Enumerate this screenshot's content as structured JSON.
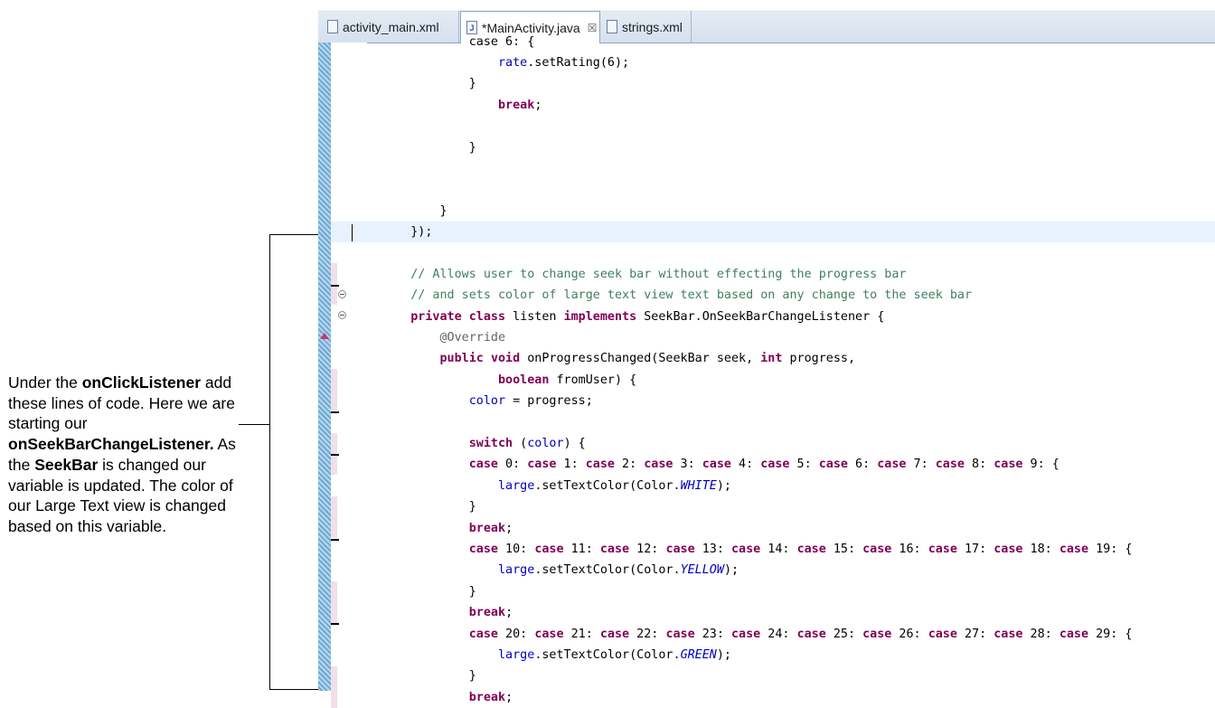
{
  "annotation": {
    "t1": "Under the ",
    "b1": "onClickListener",
    "t2": " add these lines of code. Here we are starting our ",
    "b2": "onSeekBarChangeListener.",
    "t3": " As the ",
    "b3": "SeekBar",
    "t4": " is changed our variable is updated. The color of our Large Text view is changed based on this variable."
  },
  "tabs": [
    {
      "label": "activity_main.xml",
      "icon": "xml-file-icon"
    },
    {
      "label": "*MainActivity.java",
      "icon": "java-file-icon",
      "close": "☒"
    },
    {
      "label": "strings.xml",
      "icon": "xml-file-icon"
    }
  ],
  "code": {
    "l0": [
      {
        "c": "",
        "t": "            case 6: {"
      }
    ],
    "l1": [
      {
        "c": "",
        "t": "                "
      },
      {
        "c": "fld",
        "t": "rate"
      },
      {
        "c": "",
        "t": ".setRating(6);"
      }
    ],
    "l2": [
      {
        "c": "",
        "t": "            }"
      }
    ],
    "l3": [
      {
        "c": "",
        "t": "                "
      },
      {
        "c": "kw",
        "t": "break"
      },
      {
        "c": "",
        "t": ";"
      }
    ],
    "l4": [
      {
        "c": "",
        "t": ""
      }
    ],
    "l5": [
      {
        "c": "",
        "t": "            }"
      }
    ],
    "l6": [
      {
        "c": "",
        "t": ""
      }
    ],
    "l7": [
      {
        "c": "",
        "t": ""
      }
    ],
    "l8": [
      {
        "c": "",
        "t": "        }"
      }
    ],
    "l9": [
      {
        "c": "",
        "t": "    });"
      }
    ],
    "l10": [
      {
        "c": "",
        "t": ""
      }
    ],
    "l11": [
      {
        "c": "",
        "t": "    "
      },
      {
        "c": "cm",
        "t": "// Allows user to change seek bar without effecting the progress bar"
      }
    ],
    "l12": [
      {
        "c": "",
        "t": "    "
      },
      {
        "c": "cm",
        "t": "// and sets color of large text view text based on any change to the seek bar"
      }
    ],
    "l13": [
      {
        "c": "",
        "t": "    "
      },
      {
        "c": "kw",
        "t": "private"
      },
      {
        "c": "",
        "t": " "
      },
      {
        "c": "kw",
        "t": "class"
      },
      {
        "c": "",
        "t": " listen "
      },
      {
        "c": "kw",
        "t": "implements"
      },
      {
        "c": "",
        "t": " SeekBar.OnSeekBarChangeListener {"
      }
    ],
    "l14": [
      {
        "c": "",
        "t": "        "
      },
      {
        "c": "an",
        "t": "@Override"
      }
    ],
    "l15": [
      {
        "c": "",
        "t": "        "
      },
      {
        "c": "kw",
        "t": "public"
      },
      {
        "c": "",
        "t": " "
      },
      {
        "c": "kw",
        "t": "void"
      },
      {
        "c": "",
        "t": " onProgressChanged(SeekBar seek, "
      },
      {
        "c": "kw",
        "t": "int"
      },
      {
        "c": "",
        "t": " progress,"
      }
    ],
    "l16": [
      {
        "c": "",
        "t": "                "
      },
      {
        "c": "kw",
        "t": "boolean"
      },
      {
        "c": "",
        "t": " fromUser) {"
      }
    ],
    "l17": [
      {
        "c": "",
        "t": "            "
      },
      {
        "c": "fld",
        "t": "color"
      },
      {
        "c": "",
        "t": " = progress;"
      }
    ],
    "l18": [
      {
        "c": "",
        "t": ""
      }
    ],
    "l19": [
      {
        "c": "",
        "t": "            "
      },
      {
        "c": "kw",
        "t": "switch"
      },
      {
        "c": "",
        "t": " ("
      },
      {
        "c": "fld",
        "t": "color"
      },
      {
        "c": "",
        "t": ") {"
      }
    ],
    "l20": [
      {
        "c": "",
        "t": "            "
      },
      {
        "c": "kw",
        "t": "case"
      },
      {
        "c": "",
        "t": " 0: "
      },
      {
        "c": "kw",
        "t": "case"
      },
      {
        "c": "",
        "t": " 1: "
      },
      {
        "c": "kw",
        "t": "case"
      },
      {
        "c": "",
        "t": " 2: "
      },
      {
        "c": "kw",
        "t": "case"
      },
      {
        "c": "",
        "t": " 3: "
      },
      {
        "c": "kw",
        "t": "case"
      },
      {
        "c": "",
        "t": " 4: "
      },
      {
        "c": "kw",
        "t": "case"
      },
      {
        "c": "",
        "t": " 5: "
      },
      {
        "c": "kw",
        "t": "case"
      },
      {
        "c": "",
        "t": " 6: "
      },
      {
        "c": "kw",
        "t": "case"
      },
      {
        "c": "",
        "t": " 7: "
      },
      {
        "c": "kw",
        "t": "case"
      },
      {
        "c": "",
        "t": " 8: "
      },
      {
        "c": "kw",
        "t": "case"
      },
      {
        "c": "",
        "t": " 9: {"
      }
    ],
    "l21": [
      {
        "c": "",
        "t": "                "
      },
      {
        "c": "fld",
        "t": "large"
      },
      {
        "c": "",
        "t": ".setTextColor(Color."
      },
      {
        "c": "sfld",
        "t": "WHITE"
      },
      {
        "c": "",
        "t": ");"
      }
    ],
    "l22": [
      {
        "c": "",
        "t": "            }"
      }
    ],
    "l23": [
      {
        "c": "",
        "t": "            "
      },
      {
        "c": "kw",
        "t": "break"
      },
      {
        "c": "",
        "t": ";"
      }
    ],
    "l24": [
      {
        "c": "",
        "t": "            "
      },
      {
        "c": "kw",
        "t": "case"
      },
      {
        "c": "",
        "t": " 10: "
      },
      {
        "c": "kw",
        "t": "case"
      },
      {
        "c": "",
        "t": " 11: "
      },
      {
        "c": "kw",
        "t": "case"
      },
      {
        "c": "",
        "t": " 12: "
      },
      {
        "c": "kw",
        "t": "case"
      },
      {
        "c": "",
        "t": " 13: "
      },
      {
        "c": "kw",
        "t": "case"
      },
      {
        "c": "",
        "t": " 14: "
      },
      {
        "c": "kw",
        "t": "case"
      },
      {
        "c": "",
        "t": " 15: "
      },
      {
        "c": "kw",
        "t": "case"
      },
      {
        "c": "",
        "t": " 16: "
      },
      {
        "c": "kw",
        "t": "case"
      },
      {
        "c": "",
        "t": " 17: "
      },
      {
        "c": "kw",
        "t": "case"
      },
      {
        "c": "",
        "t": " 18: "
      },
      {
        "c": "kw",
        "t": "case"
      },
      {
        "c": "",
        "t": " 19: {"
      }
    ],
    "l25": [
      {
        "c": "",
        "t": "                "
      },
      {
        "c": "fld",
        "t": "large"
      },
      {
        "c": "",
        "t": ".setTextColor(Color."
      },
      {
        "c": "sfld",
        "t": "YELLOW"
      },
      {
        "c": "",
        "t": ");"
      }
    ],
    "l26": [
      {
        "c": "",
        "t": "            }"
      }
    ],
    "l27": [
      {
        "c": "",
        "t": "            "
      },
      {
        "c": "kw",
        "t": "break"
      },
      {
        "c": "",
        "t": ";"
      }
    ],
    "l28": [
      {
        "c": "",
        "t": "            "
      },
      {
        "c": "kw",
        "t": "case"
      },
      {
        "c": "",
        "t": " 20: "
      },
      {
        "c": "kw",
        "t": "case"
      },
      {
        "c": "",
        "t": " 21: "
      },
      {
        "c": "kw",
        "t": "case"
      },
      {
        "c": "",
        "t": " 22: "
      },
      {
        "c": "kw",
        "t": "case"
      },
      {
        "c": "",
        "t": " 23: "
      },
      {
        "c": "kw",
        "t": "case"
      },
      {
        "c": "",
        "t": " 24: "
      },
      {
        "c": "kw",
        "t": "case"
      },
      {
        "c": "",
        "t": " 25: "
      },
      {
        "c": "kw",
        "t": "case"
      },
      {
        "c": "",
        "t": " 26: "
      },
      {
        "c": "kw",
        "t": "case"
      },
      {
        "c": "",
        "t": " 27: "
      },
      {
        "c": "kw",
        "t": "case"
      },
      {
        "c": "",
        "t": " 28: "
      },
      {
        "c": "kw",
        "t": "case"
      },
      {
        "c": "",
        "t": " 29: {"
      }
    ],
    "l29": [
      {
        "c": "",
        "t": "                "
      },
      {
        "c": "fld",
        "t": "large"
      },
      {
        "c": "",
        "t": ".setTextColor(Color."
      },
      {
        "c": "sfld",
        "t": "GREEN"
      },
      {
        "c": "",
        "t": ");"
      }
    ],
    "l30": [
      {
        "c": "",
        "t": "            }"
      }
    ],
    "l31": [
      {
        "c": "",
        "t": "            "
      },
      {
        "c": "kw",
        "t": "break"
      },
      {
        "c": "",
        "t": ";"
      }
    ]
  },
  "colors": {
    "keyword": "#7f0055",
    "comment": "#3f7f5f",
    "field": "#0000c0",
    "annotation": "#646464",
    "current_line": "#e8f2fe"
  }
}
